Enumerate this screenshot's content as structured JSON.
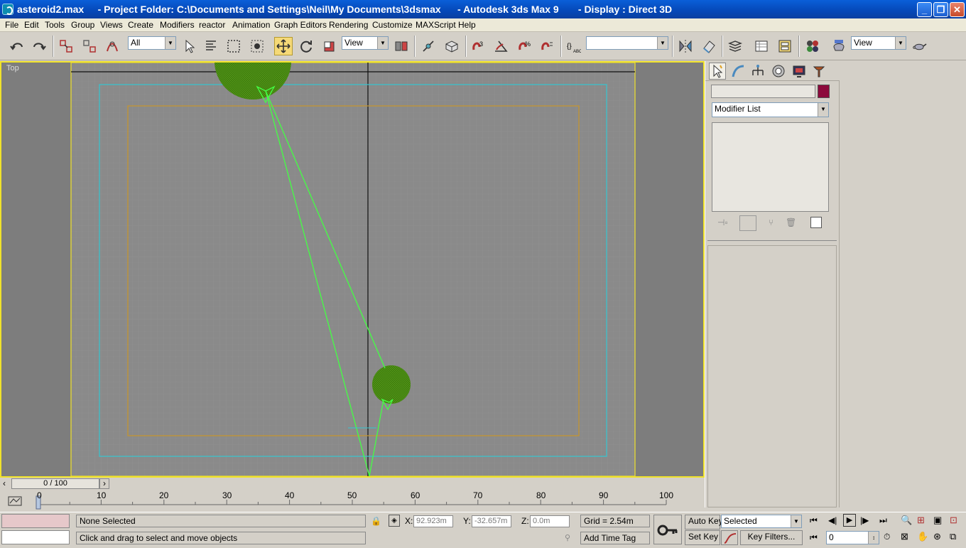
{
  "window": {
    "title": "asteroid2.max     - Project Folder: C:\\Documents and Settings\\Neil\\My Documents\\3dsmax      - Autodesk 3ds Max 9       - Display : Direct 3D"
  },
  "menu": [
    "File",
    "Edit",
    "Tools",
    "Group",
    "Views",
    "Create",
    "Modifiers",
    "reactor",
    "Animation",
    "Graph Editors",
    "Rendering",
    "Customize",
    "MAXScript",
    "Help"
  ],
  "toolbar": {
    "selection_filter": "All",
    "ref_coord": "View",
    "named_selection": "",
    "view_dropdown": "View"
  },
  "viewport": {
    "label": "Top"
  },
  "timeline": {
    "frame_display": "0 / 100",
    "ticks": [
      "0",
      "10",
      "20",
      "30",
      "40",
      "50",
      "60",
      "70",
      "80",
      "90",
      "100"
    ]
  },
  "command_panel": {
    "name_field": "",
    "object_color": "#8c0a3c",
    "modifier_list": "Modifier List"
  },
  "status": {
    "selection": "None Selected",
    "prompt": "Click and drag to select and move objects",
    "x_label": "X:",
    "x_value": "92.923m",
    "y_label": "Y:",
    "y_value": "-32.657m",
    "z_label": "Z:",
    "z_value": "0.0m",
    "grid": "Grid = 2.54m",
    "add_time_tag": "Add Time Tag",
    "auto_key": "Auto Key",
    "set_key": "Set Key",
    "key_mode": "Selected",
    "key_filters": "Key Filters...",
    "current_frame": "0"
  },
  "colors": {
    "viewport_border": "#f0e22a",
    "sphere": "#4a8a10",
    "bone": "#44ff44",
    "safe_frame_outer": "#35c5d0",
    "safe_frame_inner": "#c8962a"
  }
}
